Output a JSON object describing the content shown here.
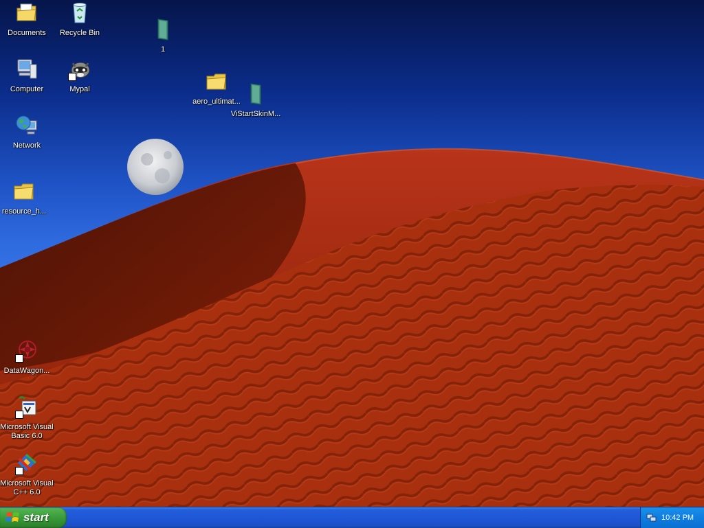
{
  "desktop": {
    "icons": [
      {
        "label": "Documents",
        "icon": "documents-folder-icon"
      },
      {
        "label": "Recycle Bin",
        "icon": "recycle-bin-icon"
      },
      {
        "label": "1",
        "icon": "green-book-icon"
      },
      {
        "label": "Computer",
        "icon": "computer-icon"
      },
      {
        "label": "Mypal",
        "icon": "mypal-raccoon-icon"
      },
      {
        "label": "aero_ultimat...",
        "icon": "folder-icon"
      },
      {
        "label": "ViStartSkinM...",
        "icon": "green-book-icon"
      },
      {
        "label": "Network",
        "icon": "network-globe-icon"
      },
      {
        "label": "resource_h...",
        "icon": "folder-icon"
      },
      {
        "label": "DataWagon...",
        "icon": "datawagon-icon"
      },
      {
        "label": "Microsoft Visual Basic 6.0",
        "icon": "visual-basic-icon"
      },
      {
        "label": "Microsoft Visual C++ 6.0",
        "icon": "visual-cpp-icon"
      }
    ]
  },
  "taskbar": {
    "start_label": "start",
    "clock": "10:42 PM"
  }
}
